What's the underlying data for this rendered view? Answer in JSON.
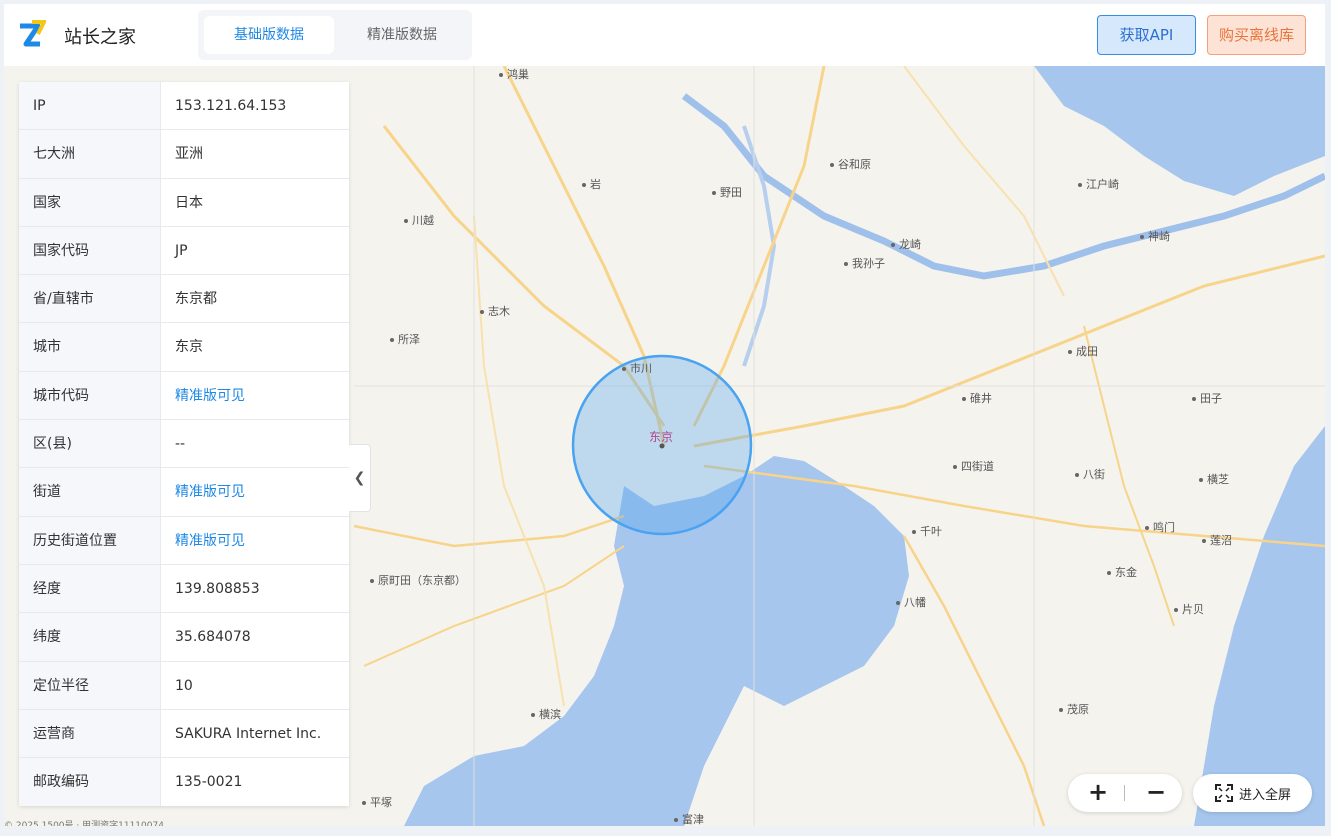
{
  "header": {
    "brand": "站长之家",
    "tabs": [
      {
        "label": "基础版数据",
        "active": true
      },
      {
        "label": "精准版数据",
        "active": false
      }
    ],
    "api_button": "获取API",
    "buy_button": "购买离线库"
  },
  "info": [
    {
      "key": "IP",
      "value": "153.121.64.153",
      "link": false
    },
    {
      "key": "七大洲",
      "value": "亚洲",
      "link": false
    },
    {
      "key": "国家",
      "value": "日本",
      "link": false
    },
    {
      "key": "国家代码",
      "value": "JP",
      "link": false
    },
    {
      "key": "省/直辖市",
      "value": "东京都",
      "link": false
    },
    {
      "key": "城市",
      "value": "东京",
      "link": false
    },
    {
      "key": "城市代码",
      "value": "精准版可见",
      "link": true
    },
    {
      "key": "区(县)",
      "value": "--",
      "link": false
    },
    {
      "key": "街道",
      "value": "精准版可见",
      "link": true
    },
    {
      "key": "历史街道位置",
      "value": "精准版可见",
      "link": true
    },
    {
      "key": "经度",
      "value": "139.808853",
      "link": false
    },
    {
      "key": "纬度",
      "value": "35.684078",
      "link": false
    },
    {
      "key": "定位半径",
      "value": "10",
      "link": false
    },
    {
      "key": "运营商",
      "value": "SAKURA Internet Inc.",
      "link": false
    },
    {
      "key": "邮政编码",
      "value": "135-0021",
      "link": false
    }
  ],
  "map": {
    "center_label": "东京",
    "places": {
      "kounosu": "鸿巢",
      "iwatsuki": "岩",
      "noda": "野田",
      "yawara": "谷和原",
      "edosaki": "江户崎",
      "kawagoe": "川越",
      "ryugasaki": "龙崎",
      "abiko": "我孙子",
      "kozaki": "神崎",
      "shiki": "志木",
      "tokorozawa": "所泽",
      "ichikawa": "市川",
      "narita": "成田",
      "usui": "碓井",
      "tako": "田子",
      "yotsukaido": "四街道",
      "yachimata": "八街",
      "yokoshiba": "横芝",
      "chiba": "千叶",
      "naruto": "鸣门",
      "hasunuma": "莲沼",
      "machida": "原町田（东京都）",
      "togane": "东金",
      "yawata": "八幡",
      "katakai": "片贝",
      "yokohama": "横滨",
      "mobara": "茂原",
      "hiratsuka": "平塚",
      "futtsu": "富津"
    },
    "zoom_in": "+",
    "zoom_out": "−",
    "fullscreen_label": "进入全屏",
    "copyright": "© 2025 1500号 · 甲测资字11110074"
  },
  "colors": {
    "accent": "#1e88e5",
    "buy": "#e8743b",
    "water": "#a6c6ee",
    "circle": "#4aa3f0"
  }
}
